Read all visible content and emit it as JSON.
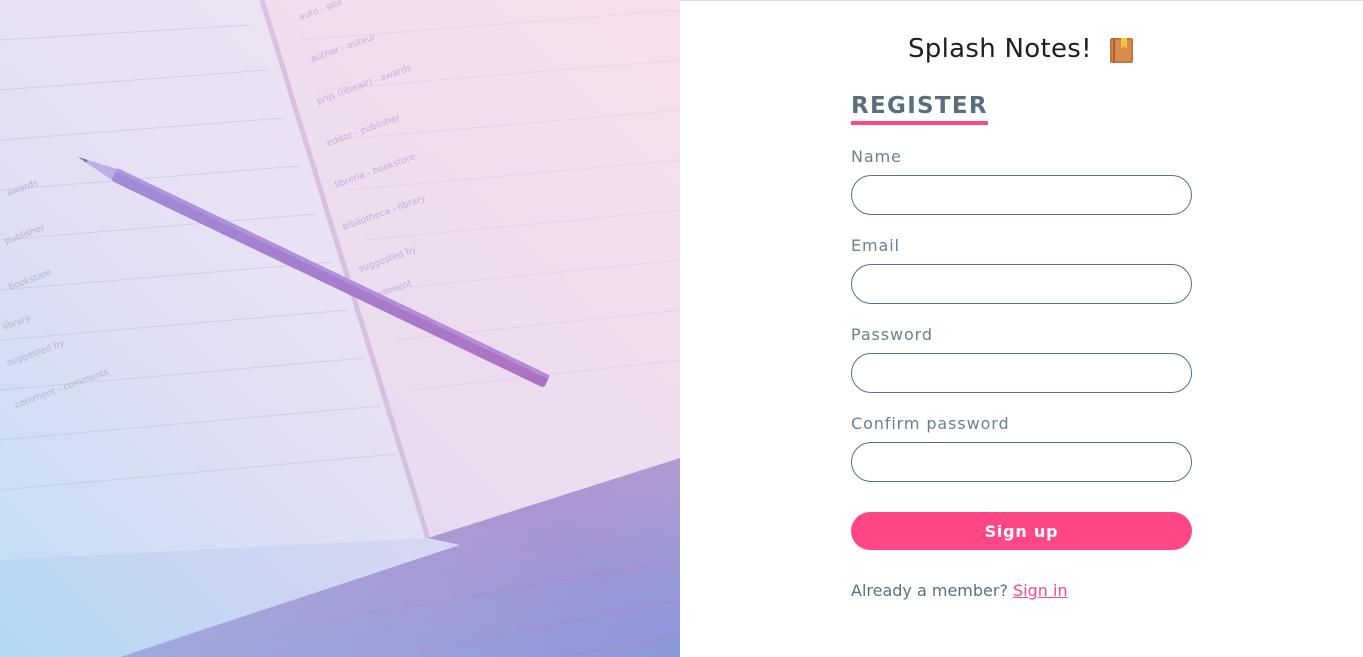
{
  "app": {
    "title": "Splash Notes!",
    "title_icon": "notebook-icon"
  },
  "form": {
    "heading": "REGISTER",
    "fields": [
      {
        "label": "Name",
        "value": "",
        "type": "text"
      },
      {
        "label": "Email",
        "value": "",
        "type": "email"
      },
      {
        "label": "Password",
        "value": "",
        "type": "password"
      },
      {
        "label": "Confirm password",
        "value": "",
        "type": "password"
      }
    ],
    "submit_label": "Sign up",
    "footer_text": "Already a member?",
    "signin_label": "Sign in"
  },
  "colors": {
    "accent": "#ff4785",
    "heading": "#5a6f7d",
    "label": "#6c7f8c",
    "input_border": "#5a6f7d"
  },
  "hero_image": {
    "subject": "open notebook with pencil",
    "handwritten_lines": [
      "auto - site",
      "author - auteur",
      "prijs (literair) - awards",
      "editor - publisher",
      "libreria - bookstore",
      "bibliotheca - library",
      "suggested by",
      "comment",
      "notes",
      "awards",
      "publisher",
      "bookstore",
      "library",
      "suggested by",
      "comment - comments"
    ]
  }
}
